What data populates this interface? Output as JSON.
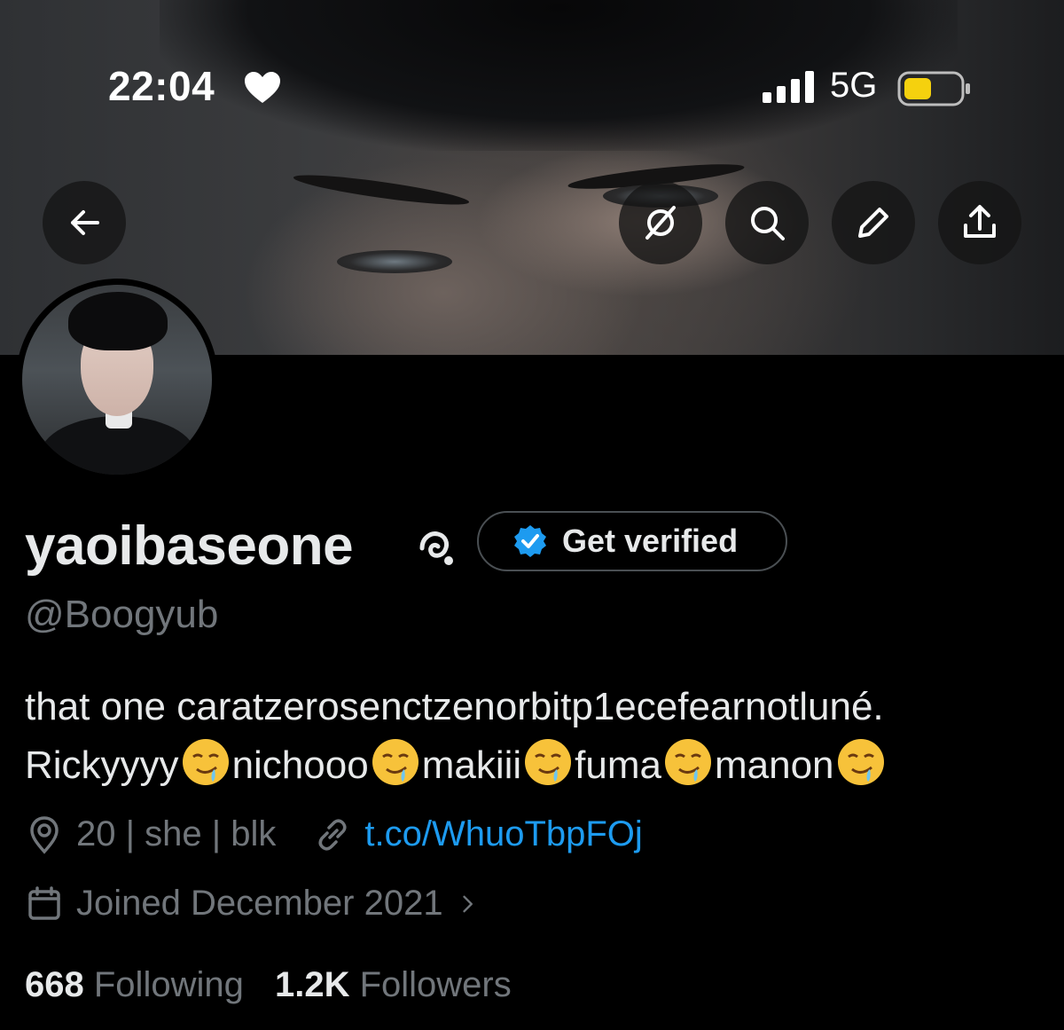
{
  "status_bar": {
    "time": "22:04",
    "network": "5G",
    "icons": [
      "heart-icon",
      "signal-icon",
      "battery-icon"
    ]
  },
  "header_actions": {
    "back": "arrow-left-icon",
    "actions": [
      "grok-icon",
      "search-icon",
      "pencil-icon",
      "share-icon"
    ]
  },
  "profile": {
    "display_name": "yaoibaseone",
    "get_verified_label": "Get verified",
    "handle": "@Boogyub",
    "bio_line1": "that one caratzerosenctzenorbitp1ecefearnotluné.",
    "bio_line2_words": [
      "Rickyyyy",
      "nichooo",
      "makiii",
      "fuma",
      "manon"
    ],
    "bio_emoji": "drooling-face-emoji",
    "location": "20 | she | blk",
    "website": "t.co/WhuoTbpFOj",
    "joined": "Joined December 2021",
    "following_count": "668",
    "following_label": "Following",
    "followers_count": "1.2K",
    "followers_label": "Followers"
  },
  "colors": {
    "background": "#000000",
    "text_primary": "#e7e9ea",
    "text_secondary": "#71767b",
    "link": "#1d9bf0",
    "verified_badge": "#1d9bf0",
    "battery": "#f5d10e"
  }
}
